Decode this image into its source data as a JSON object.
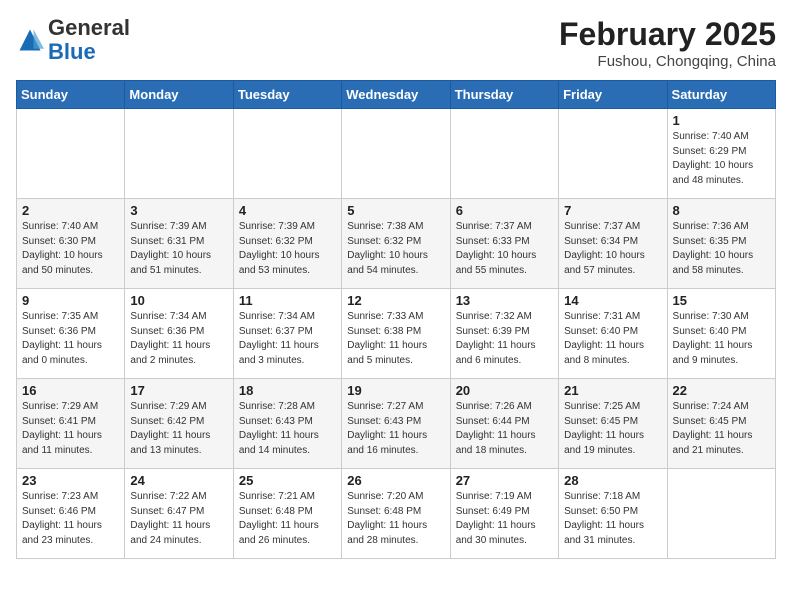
{
  "header": {
    "logo_general": "General",
    "logo_blue": "Blue",
    "month_year": "February 2025",
    "location": "Fushou, Chongqing, China"
  },
  "weekdays": [
    "Sunday",
    "Monday",
    "Tuesday",
    "Wednesday",
    "Thursday",
    "Friday",
    "Saturday"
  ],
  "weeks": [
    [
      {
        "day": "",
        "info": ""
      },
      {
        "day": "",
        "info": ""
      },
      {
        "day": "",
        "info": ""
      },
      {
        "day": "",
        "info": ""
      },
      {
        "day": "",
        "info": ""
      },
      {
        "day": "",
        "info": ""
      },
      {
        "day": "1",
        "info": "Sunrise: 7:40 AM\nSunset: 6:29 PM\nDaylight: 10 hours and 48 minutes."
      }
    ],
    [
      {
        "day": "2",
        "info": "Sunrise: 7:40 AM\nSunset: 6:30 PM\nDaylight: 10 hours and 50 minutes."
      },
      {
        "day": "3",
        "info": "Sunrise: 7:39 AM\nSunset: 6:31 PM\nDaylight: 10 hours and 51 minutes."
      },
      {
        "day": "4",
        "info": "Sunrise: 7:39 AM\nSunset: 6:32 PM\nDaylight: 10 hours and 53 minutes."
      },
      {
        "day": "5",
        "info": "Sunrise: 7:38 AM\nSunset: 6:32 PM\nDaylight: 10 hours and 54 minutes."
      },
      {
        "day": "6",
        "info": "Sunrise: 7:37 AM\nSunset: 6:33 PM\nDaylight: 10 hours and 55 minutes."
      },
      {
        "day": "7",
        "info": "Sunrise: 7:37 AM\nSunset: 6:34 PM\nDaylight: 10 hours and 57 minutes."
      },
      {
        "day": "8",
        "info": "Sunrise: 7:36 AM\nSunset: 6:35 PM\nDaylight: 10 hours and 58 minutes."
      }
    ],
    [
      {
        "day": "9",
        "info": "Sunrise: 7:35 AM\nSunset: 6:36 PM\nDaylight: 11 hours and 0 minutes."
      },
      {
        "day": "10",
        "info": "Sunrise: 7:34 AM\nSunset: 6:36 PM\nDaylight: 11 hours and 2 minutes."
      },
      {
        "day": "11",
        "info": "Sunrise: 7:34 AM\nSunset: 6:37 PM\nDaylight: 11 hours and 3 minutes."
      },
      {
        "day": "12",
        "info": "Sunrise: 7:33 AM\nSunset: 6:38 PM\nDaylight: 11 hours and 5 minutes."
      },
      {
        "day": "13",
        "info": "Sunrise: 7:32 AM\nSunset: 6:39 PM\nDaylight: 11 hours and 6 minutes."
      },
      {
        "day": "14",
        "info": "Sunrise: 7:31 AM\nSunset: 6:40 PM\nDaylight: 11 hours and 8 minutes."
      },
      {
        "day": "15",
        "info": "Sunrise: 7:30 AM\nSunset: 6:40 PM\nDaylight: 11 hours and 9 minutes."
      }
    ],
    [
      {
        "day": "16",
        "info": "Sunrise: 7:29 AM\nSunset: 6:41 PM\nDaylight: 11 hours and 11 minutes."
      },
      {
        "day": "17",
        "info": "Sunrise: 7:29 AM\nSunset: 6:42 PM\nDaylight: 11 hours and 13 minutes."
      },
      {
        "day": "18",
        "info": "Sunrise: 7:28 AM\nSunset: 6:43 PM\nDaylight: 11 hours and 14 minutes."
      },
      {
        "day": "19",
        "info": "Sunrise: 7:27 AM\nSunset: 6:43 PM\nDaylight: 11 hours and 16 minutes."
      },
      {
        "day": "20",
        "info": "Sunrise: 7:26 AM\nSunset: 6:44 PM\nDaylight: 11 hours and 18 minutes."
      },
      {
        "day": "21",
        "info": "Sunrise: 7:25 AM\nSunset: 6:45 PM\nDaylight: 11 hours and 19 minutes."
      },
      {
        "day": "22",
        "info": "Sunrise: 7:24 AM\nSunset: 6:45 PM\nDaylight: 11 hours and 21 minutes."
      }
    ],
    [
      {
        "day": "23",
        "info": "Sunrise: 7:23 AM\nSunset: 6:46 PM\nDaylight: 11 hours and 23 minutes."
      },
      {
        "day": "24",
        "info": "Sunrise: 7:22 AM\nSunset: 6:47 PM\nDaylight: 11 hours and 24 minutes."
      },
      {
        "day": "25",
        "info": "Sunrise: 7:21 AM\nSunset: 6:48 PM\nDaylight: 11 hours and 26 minutes."
      },
      {
        "day": "26",
        "info": "Sunrise: 7:20 AM\nSunset: 6:48 PM\nDaylight: 11 hours and 28 minutes."
      },
      {
        "day": "27",
        "info": "Sunrise: 7:19 AM\nSunset: 6:49 PM\nDaylight: 11 hours and 30 minutes."
      },
      {
        "day": "28",
        "info": "Sunrise: 7:18 AM\nSunset: 6:50 PM\nDaylight: 11 hours and 31 minutes."
      },
      {
        "day": "",
        "info": ""
      }
    ]
  ]
}
